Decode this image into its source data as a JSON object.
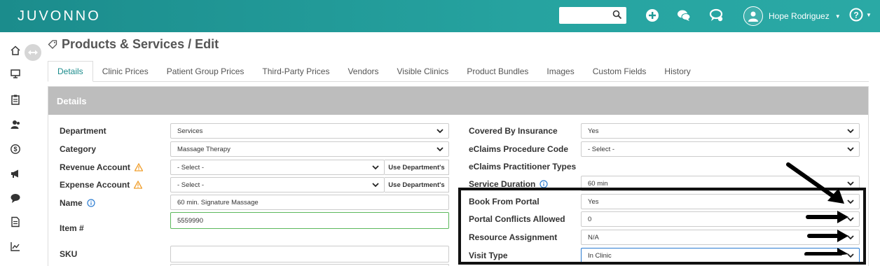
{
  "header": {
    "logo": "JUVONNO",
    "user_name": "Hope Rodriguez"
  },
  "page": {
    "title": "Products & Services / Edit"
  },
  "tabs": [
    "Details",
    "Clinic Prices",
    "Patient Group Prices",
    "Third-Party Prices",
    "Vendors",
    "Visible Clinics",
    "Product Bundles",
    "Images",
    "Custom Fields",
    "History"
  ],
  "panel": {
    "title": "Details"
  },
  "left_form": {
    "department": {
      "label": "Department",
      "value": "Services"
    },
    "category": {
      "label": "Category",
      "value": "Massage Therapy"
    },
    "revenue_account": {
      "label": "Revenue Account",
      "value": "- Select -",
      "button": "Use Department's"
    },
    "expense_account": {
      "label": "Expense Account",
      "value": "- Select -",
      "button": "Use Department's"
    },
    "name": {
      "label": "Name",
      "value": "60 min. Signature Massage"
    },
    "item_number": {
      "label": "Item #",
      "value": "5559990"
    },
    "sku": {
      "label": "SKU",
      "value": ""
    }
  },
  "right_form": {
    "covered_by_insurance": {
      "label": "Covered By Insurance",
      "value": "Yes"
    },
    "eclaims_procedure_code": {
      "label": "eClaims Procedure Code",
      "value": "- Select -"
    },
    "eclaims_practitioner_types": {
      "label": "eClaims Practitioner Types"
    },
    "service_duration": {
      "label": "Service Duration",
      "value": "60 min"
    },
    "book_from_portal": {
      "label": "Book From Portal",
      "value": "Yes"
    },
    "portal_conflicts_allowed": {
      "label": "Portal Conflicts Allowed",
      "value": "0"
    },
    "resource_assignment": {
      "label": "Resource Assignment",
      "value": "N/A"
    },
    "visit_type": {
      "label": "Visit Type",
      "value": "In Clinic"
    }
  },
  "colors": {
    "brand_teal": "#1b8c8c",
    "panel_header": "#bdbdbd",
    "warning": "#f0a030",
    "info": "#2a7bd1"
  }
}
